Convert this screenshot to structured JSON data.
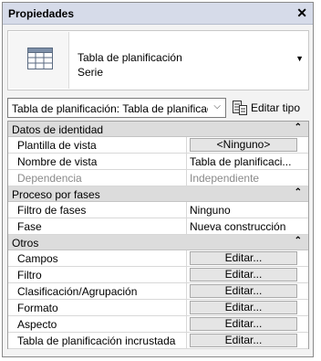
{
  "panel": {
    "title": "Propiedades",
    "close_glyph": "✕"
  },
  "type_selector": {
    "icon": "schedule-table-icon",
    "name": "Tabla de planificación",
    "subtitle": "Serie",
    "dropdown_glyph": "▼"
  },
  "instance_selector": {
    "value": "Tabla de planificación: Tabla de planificación",
    "chevron": "⌵"
  },
  "edit_type": {
    "label": "Editar tipo",
    "icon": "edit-type-icon"
  },
  "sections": [
    {
      "title": "Datos de identidad",
      "collapse_glyph": "⌃",
      "rows": [
        {
          "label": "Plantilla de vista",
          "value": "<Ninguno>",
          "kind": "button"
        },
        {
          "label": "Nombre de vista",
          "value": "Tabla de planificaci...",
          "kind": "text"
        },
        {
          "label": "Dependencia",
          "value": "Independiente",
          "kind": "disabled"
        }
      ]
    },
    {
      "title": "Proceso por fases",
      "collapse_glyph": "⌃",
      "rows": [
        {
          "label": "Filtro de fases",
          "value": "Ninguno",
          "kind": "text"
        },
        {
          "label": "Fase",
          "value": "Nueva construcción",
          "kind": "text"
        }
      ]
    },
    {
      "title": "Otros",
      "collapse_glyph": "⌃",
      "rows": [
        {
          "label": "Campos",
          "value": "Editar...",
          "kind": "button"
        },
        {
          "label": "Filtro",
          "value": "Editar...",
          "kind": "button"
        },
        {
          "label": "Clasificación/Agrupación",
          "value": "Editar...",
          "kind": "button"
        },
        {
          "label": "Formato",
          "value": "Editar...",
          "kind": "button"
        },
        {
          "label": "Aspecto",
          "value": "Editar...",
          "kind": "button"
        },
        {
          "label": "Tabla de planificación incrustada",
          "value": "Editar...",
          "kind": "button"
        }
      ]
    }
  ]
}
